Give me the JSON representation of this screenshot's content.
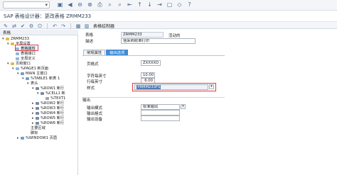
{
  "toolbar1": {
    "command_field": "",
    "icons": [
      "check-icon",
      "save-icon",
      "back-icon",
      "exit-icon",
      "cancel-icon",
      "print-icon",
      "find-icon",
      "find-next-icon",
      "first-page-icon",
      "prev-page-icon",
      "next-page-icon",
      "last-page-icon",
      "new-session-icon",
      "shortcut-icon",
      "help-icon"
    ]
  },
  "title": "SAP 表格设计器：更改表格 ZRMM233",
  "toolbar2": {
    "icons": [
      "display-change-icon",
      "other-object-icon",
      "activate-icon",
      "check-icon",
      "test-icon",
      "undo-icon",
      "redo-icon",
      "settings-icon",
      "layout-icon"
    ],
    "table_painter_label": "表格绘制器"
  },
  "tree": {
    "header": "表格",
    "nodes": [
      {
        "label": "ZRMM233",
        "level": 0
      },
      {
        "label": "全局设置",
        "level": 1
      },
      {
        "label": "表格属性",
        "level": 2,
        "selected": true
      },
      {
        "label": "表格接口",
        "level": 2
      },
      {
        "label": "全局定义",
        "level": 2
      },
      {
        "label": "页和窗口",
        "level": 1
      },
      {
        "label": "%PAGE1 新页面",
        "level": 2
      },
      {
        "label": "MAIN 主窗口",
        "level": 3
      },
      {
        "label": "%TABLE1 新表 1",
        "level": 4
      },
      {
        "label": "表头",
        "level": 5
      },
      {
        "label": "%ROW1 新行",
        "level": 6
      },
      {
        "label": "%CELL1 新",
        "level": 7
      },
      {
        "label": "%TEXT1",
        "level": 8
      },
      {
        "label": "%ROW2 新行",
        "level": 6
      },
      {
        "label": "%ROW3 新行",
        "level": 6
      },
      {
        "label": "%ROW4 新行",
        "level": 6
      },
      {
        "label": "%ROW5 新行",
        "level": 6
      },
      {
        "label": "%ROW6 新行",
        "level": 6
      },
      {
        "label": "主要区域",
        "level": 5
      },
      {
        "label": "脚标",
        "level": 5
      },
      {
        "label": "%WINDOW1 页眉",
        "level": 3
      }
    ]
  },
  "form": {
    "table_label": "表格",
    "table_value": "ZRMM233",
    "status": "活动的",
    "desc_label": "描述",
    "desc_value": "信采购收单打印",
    "tabs": [
      "常规属性",
      "输出选项"
    ],
    "active_tab": 1,
    "page_format_label": "页格式",
    "page_format_value": "ZXXXXD",
    "chars_per_inch_label": "字符每英寸",
    "chars_per_inch_value": "10.00",
    "lines_per_inch_label": "行每英寸",
    "lines_per_inch_value": "6.00",
    "style_label": "样式",
    "style_value": "YRMM233FS",
    "output_section": "输出",
    "output_mode_label": "输出模式",
    "output_mode_value": "标准输出",
    "output_format_label": "输出格式",
    "output_device_label": "输出设备"
  },
  "colors": {
    "active_tab": "#3f8bd6",
    "highlight": "#e23a3a",
    "selection": "#d6e4f5"
  }
}
